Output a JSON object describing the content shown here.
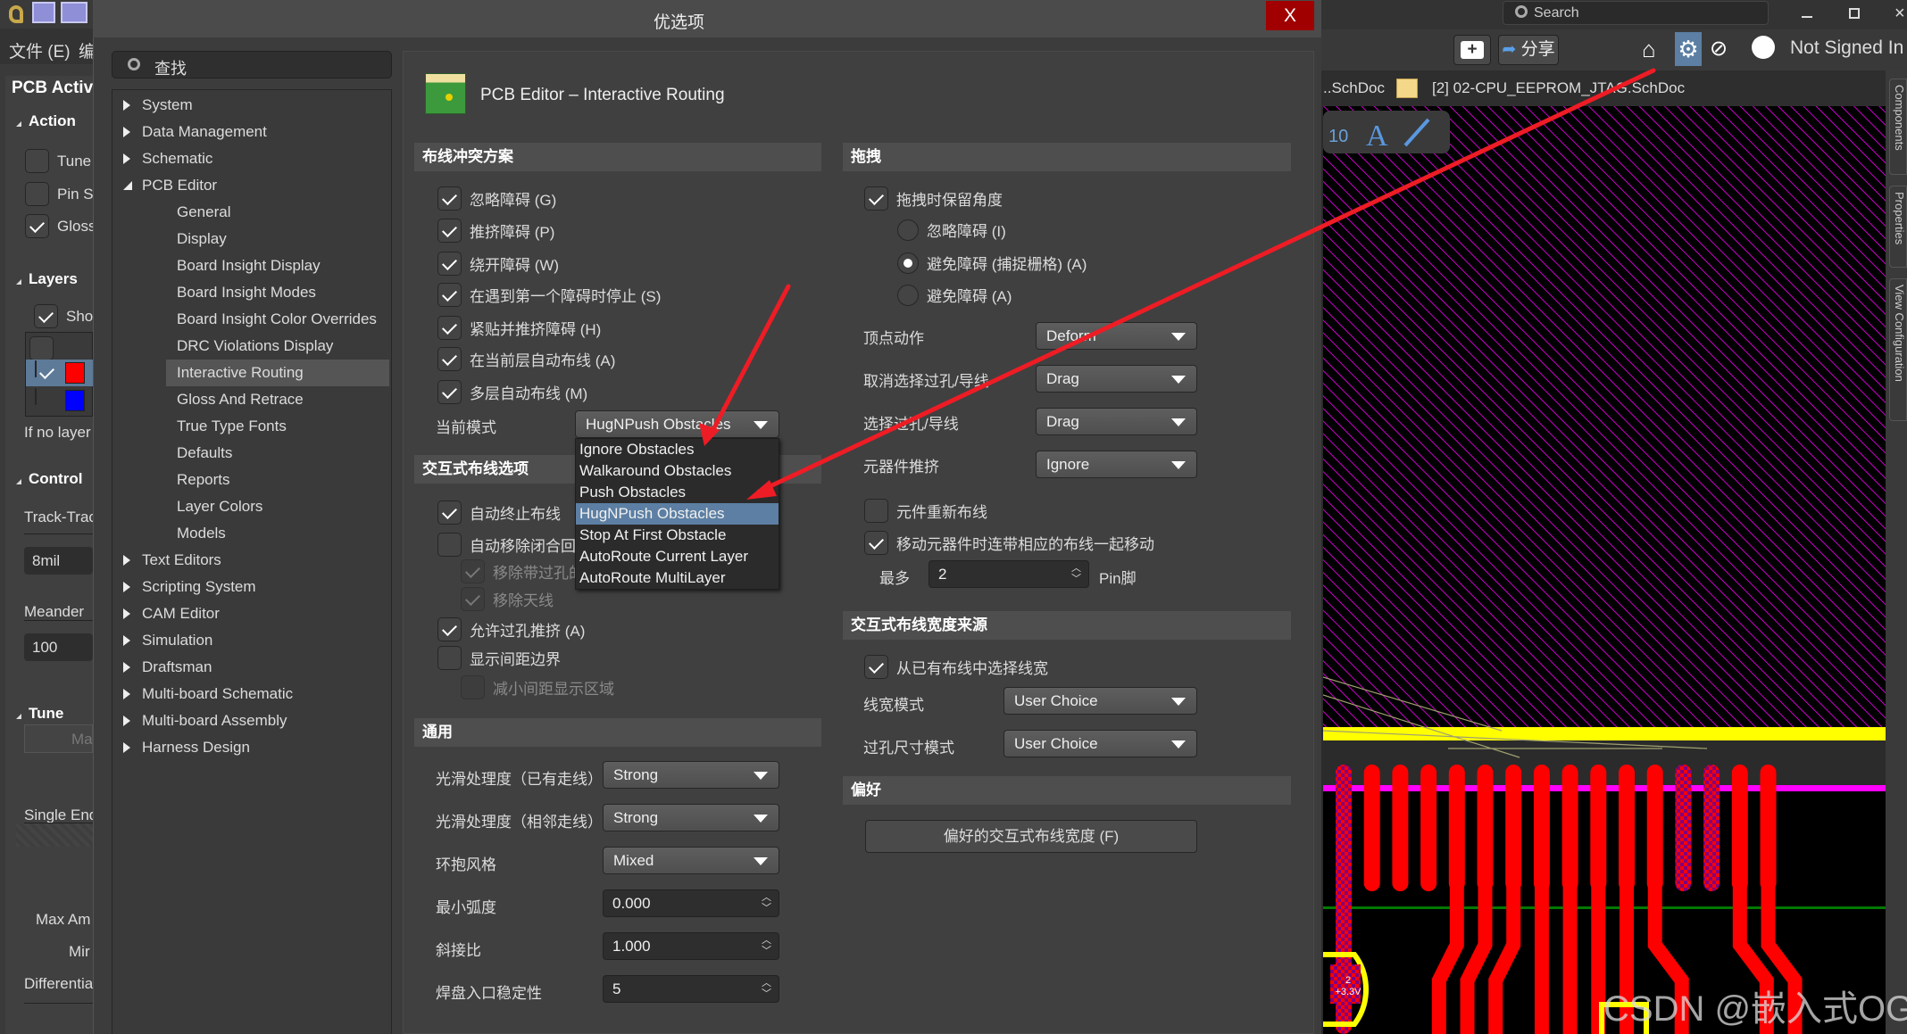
{
  "app": {
    "menu_file": "文件 (E)",
    "menu_edit": "编",
    "search_placeholder": "Search",
    "share_label": "分享",
    "user_label": "Not Signed In",
    "doc_tabs": [
      "..SchDoc",
      "[2] 02-CPU_EEPROM_JTAG.SchDoc"
    ],
    "side_tabs": [
      "Components",
      "Properties",
      "View Configuration"
    ],
    "toolbar_icons": [
      "add-comment-icon",
      "share-icon",
      "home-icon",
      "gear-icon",
      "eye-slash-icon",
      "user-icon"
    ],
    "pcb_label_pad": "2",
    "pcb_label_net": "+3.3V",
    "watermark": "CSDN @嵌入式OG"
  },
  "left_panel": {
    "title": "PCB Active",
    "action": "Action",
    "action_items": [
      {
        "label": "Tune ",
        "checked": false
      },
      {
        "label": "Pin Sw",
        "checked": false
      },
      {
        "label": "Gloss",
        "checked": true
      }
    ],
    "layers": "Layers",
    "show": "Show",
    "layer_colors": [
      "#ff0000",
      "#0000ff"
    ],
    "no_layer": "If no layer",
    "control": "Control",
    "track": "Track-Trac",
    "track_value": "8mil",
    "meander": "Meander ",
    "meander_value": "100",
    "tune": "Tune",
    "tune_placeholder": "Ma",
    "single_end": "Single End",
    "max_amp": "Max Am",
    "min": "Mir",
    "differential": "Differentia"
  },
  "dialog": {
    "title": "优选项",
    "close": "X",
    "search_placeholder": "查找",
    "page_title": "PCB Editor – Interactive Routing",
    "tree": [
      {
        "label": "System",
        "level": 0,
        "expanded": false
      },
      {
        "label": "Data Management",
        "level": 0,
        "expanded": false
      },
      {
        "label": "Schematic",
        "level": 0,
        "expanded": false
      },
      {
        "label": "PCB Editor",
        "level": 0,
        "expanded": true
      },
      {
        "label": "General",
        "level": 1
      },
      {
        "label": "Display",
        "level": 1
      },
      {
        "label": "Board Insight Display",
        "level": 1
      },
      {
        "label": "Board Insight Modes",
        "level": 1
      },
      {
        "label": "Board Insight Color Overrides",
        "level": 1
      },
      {
        "label": "DRC Violations Display",
        "level": 1
      },
      {
        "label": "Interactive Routing",
        "level": 1,
        "selected": true
      },
      {
        "label": "Gloss And Retrace",
        "level": 1
      },
      {
        "label": "True Type Fonts",
        "level": 1
      },
      {
        "label": "Defaults",
        "level": 1
      },
      {
        "label": "Reports",
        "level": 1
      },
      {
        "label": "Layer Colors",
        "level": 1
      },
      {
        "label": "Models",
        "level": 1
      },
      {
        "label": "Text Editors",
        "level": 0,
        "expanded": false
      },
      {
        "label": "Scripting System",
        "level": 0,
        "expanded": false
      },
      {
        "label": "CAM Editor",
        "level": 0,
        "expanded": false
      },
      {
        "label": "Simulation",
        "level": 0,
        "expanded": false
      },
      {
        "label": "Draftsman",
        "level": 0,
        "expanded": false
      },
      {
        "label": "Multi-board Schematic",
        "level": 0,
        "expanded": false
      },
      {
        "label": "Multi-board Assembly",
        "level": 0,
        "expanded": false
      },
      {
        "label": "Harness Design",
        "level": 0,
        "expanded": false
      }
    ],
    "conflict": {
      "header": "布线冲突方案",
      "options": [
        {
          "label": "忽略障碍 (G)",
          "checked": true
        },
        {
          "label": "推挤障碍 (P)",
          "checked": true
        },
        {
          "label": "绕开障碍 (W)",
          "checked": true
        },
        {
          "label": "在遇到第一个障碍时停止 (S)",
          "checked": true
        },
        {
          "label": "紧贴并推挤障碍 (H)",
          "checked": true
        },
        {
          "label": "在当前层自动布线 (A)",
          "checked": true
        },
        {
          "label": "多层自动布线 (M)",
          "checked": true
        }
      ],
      "mode_label": "当前模式",
      "mode_value": "HugNPush Obstacles",
      "mode_options": [
        "Ignore Obstacles",
        "Walkaround Obstacles",
        "Push Obstacles",
        "HugNPush Obstacles",
        "Stop At First Obstacle",
        "AutoRoute Current Layer",
        "AutoRoute MultiLayer"
      ],
      "mode_highlighted": "HugNPush Obstacles"
    },
    "interactive": {
      "header": "交互式布线选项",
      "auto_terminate": {
        "label": "自动终止布线",
        "checked": true
      },
      "auto_remove_loops": {
        "label": "自动移除闭合回路",
        "checked": false
      },
      "remove_via_loops": {
        "label": "移除带过孔的回路",
        "checked": true,
        "disabled": true
      },
      "remove_antennas": {
        "label": "移除天线",
        "checked": true,
        "disabled": true
      },
      "allow_via_push": {
        "label": "允许过孔推挤 (A)",
        "checked": true
      },
      "show_clearance": {
        "label": "显示间距边界",
        "checked": false
      },
      "reduce_clearance": {
        "label": "减小间距显示区域",
        "checked": false,
        "disabled": true
      }
    },
    "general": {
      "header": "通用",
      "smooth_existing_label": "光滑处理度（已有走线）",
      "smooth_existing_value": "Strong",
      "smooth_adjacent_label": "光滑处理度（相邻走线）",
      "smooth_adjacent_value": "Strong",
      "hug_style_label": "环抱风格",
      "hug_style_value": "Mixed",
      "min_arc_label": "最小弧度",
      "min_arc_value": "0.000",
      "miter_label": "斜接比",
      "miter_value": "1.000",
      "pad_entry_label": "焊盘入口稳定性",
      "pad_entry_value": "5"
    },
    "drag": {
      "header": "拖拽",
      "preserve_angle": {
        "label": "拖拽时保留角度",
        "checked": true
      },
      "radios": [
        {
          "label": "忽略障碍 (I)",
          "selected": false
        },
        {
          "label": "避免障碍 (捕捉栅格) (A)",
          "selected": true
        },
        {
          "label": "避免障碍 (A)",
          "selected": false
        }
      ],
      "vertex_label": "顶点动作",
      "vertex_value": "Deform",
      "unselected_label": "取消选择过孔/导线",
      "unselected_value": "Drag",
      "selected_label": "选择过孔/导线",
      "selected_value": "Drag",
      "component_push_label": "元器件推挤",
      "component_push_value": "Ignore",
      "reroute": {
        "label": "元件重新布线",
        "checked": false
      },
      "move_with_tracks": {
        "label": "移动元器件时连带相应的布线一起移动",
        "checked": true
      },
      "max_label": "最多",
      "max_value": "2",
      "max_unit": "Pin脚"
    },
    "width_source": {
      "header": "交互式布线宽度来源",
      "pickup": {
        "label": "从已有布线中选择线宽",
        "checked": true
      },
      "width_mode_label": "线宽模式",
      "width_mode_value": "User Choice",
      "via_mode_label": "过孔尺寸模式",
      "via_mode_value": "User Choice"
    },
    "favorites": {
      "header": "偏好",
      "button": "偏好的交互式布线宽度 (F)"
    }
  },
  "colors": {
    "accent_highlight": "#5c7fa3",
    "close_button": "#a00000",
    "annotation_arrow": "#ee1c25",
    "pcb_top_layer": "#ff0000",
    "pcb_keepout": "#ffff00",
    "pcb_hatch": "#ff00ff"
  }
}
